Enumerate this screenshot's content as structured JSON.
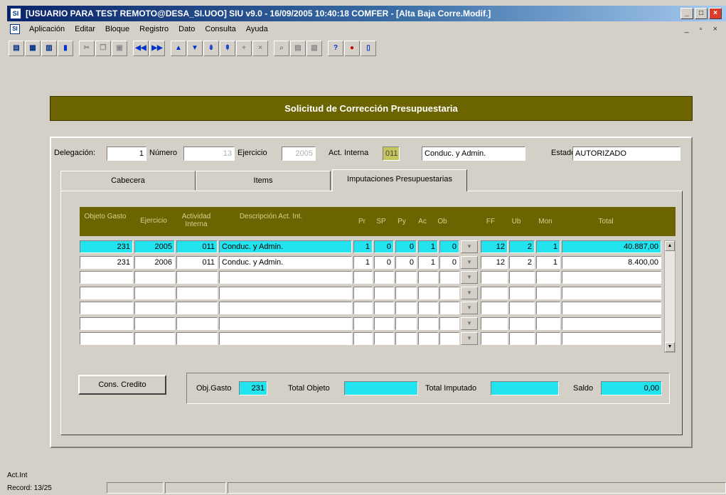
{
  "window": {
    "title": "[USUARIO PARA TEST REMOTO@DESA_SI.UOO] SIU v9.0 - 16/09/2005 10:40:18 COMFER - [Alta Baja Corre.Modif.]",
    "app_icon_text": "SI"
  },
  "menu": [
    "Aplicación",
    "Editar",
    "Bloque",
    "Registro",
    "Dato",
    "Consulta",
    "Ayuda"
  ],
  "toolbar": {
    "icons": [
      "save-icon",
      "print-icon",
      "print-preview-icon",
      "exit-icon",
      "cut-icon",
      "copy-icon",
      "paste-icon",
      "first-record-icon",
      "last-record-icon",
      "prev-record-icon",
      "next-record-icon",
      "prev-block-icon",
      "next-block-icon",
      "insert-record-icon",
      "delete-record-icon",
      "query-icon",
      "execute-query-icon",
      "cancel-query-icon",
      "help-icon",
      "stop-icon",
      "info-icon"
    ]
  },
  "form": {
    "title": "Solicitud de Corrección Presupuestaria",
    "delegacion_label": "Delegación:",
    "delegacion": "1",
    "numero_label": "Número",
    "numero": "13",
    "ejercicio_label": "Ejercicio",
    "ejercicio": "2005",
    "act_interna_label": "Act. Interna",
    "act_interna": "011",
    "act_desc": "Conduc. y Admin.",
    "estado_label": "Estado",
    "estado": "AUTORIZADO"
  },
  "tabs": [
    {
      "label": "Cabecera"
    },
    {
      "label": "Items"
    },
    {
      "label": "Imputaciones Presupuestarias"
    }
  ],
  "grid": {
    "headers": {
      "objeto": "Objeto Gasto",
      "ejercicio": "Ejercicio",
      "actividad": "Actividad Interna",
      "descripcion": "Descripción Act. Int.",
      "pr": "Pr",
      "sp": "SP",
      "py": "Py",
      "ac": "Ac",
      "ob": "Ob",
      "ff": "FF",
      "ub": "Ub",
      "mon": "Mon",
      "total": "Total"
    },
    "rows": [
      {
        "objeto": "231",
        "ejercicio": "2005",
        "actividad": "011",
        "descripcion": "Conduc. y Admin.",
        "pr": "1",
        "sp": "0",
        "py": "0",
        "ac": "1",
        "ob": "0",
        "ff": "12",
        "ub": "2",
        "mon": "1",
        "total": "40.887,00"
      },
      {
        "objeto": "231",
        "ejercicio": "2006",
        "actividad": "011",
        "descripcion": "Conduc. y Admin.",
        "pr": "1",
        "sp": "0",
        "py": "0",
        "ac": "1",
        "ob": "0",
        "ff": "12",
        "ub": "2",
        "mon": "1",
        "total": "8.400,00"
      }
    ]
  },
  "bottom": {
    "cons_credito": "Cons. Credito",
    "obj_gasto_label": "Obj.Gasto",
    "obj_gasto": "231",
    "total_objeto_label": "Total Objeto",
    "total_objeto": "",
    "total_imputado_label": "Total Imputado",
    "total_imputado": "",
    "saldo_label": "Saldo",
    "saldo": "0,00"
  },
  "status": {
    "field": "Act.Int",
    "record": "Record: 13/25"
  }
}
